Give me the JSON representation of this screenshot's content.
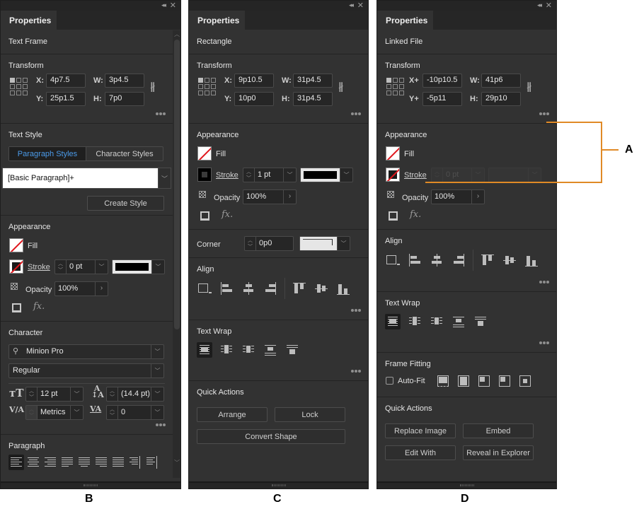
{
  "panels": {
    "b": {
      "caption": "B",
      "tab": "Properties",
      "object_type": "Text Frame",
      "transform": {
        "title": "Transform",
        "x_label": "X:",
        "y_label": "Y:",
        "w_label": "W:",
        "h_label": "H:",
        "x": "4p7.5",
        "y": "25p1.5",
        "w": "3p4.5",
        "h": "7p0"
      },
      "text_style": {
        "title": "Text Style",
        "tabs": [
          "Paragraph Styles",
          "Character Styles"
        ],
        "active_tab": "Paragraph Styles",
        "selected_style": "[Basic Paragraph]+",
        "create_button": "Create Style"
      },
      "appearance": {
        "title": "Appearance",
        "fill_label": "Fill",
        "stroke_label": "Stroke",
        "stroke_weight": "0 pt",
        "opacity_label": "Opacity",
        "opacity": "100%"
      },
      "character": {
        "title": "Character",
        "font_family": "Minion Pro",
        "font_style": "Regular",
        "font_size": "12 pt",
        "leading": "(14.4 pt)",
        "kerning": "Metrics",
        "tracking": "0"
      },
      "paragraph": {
        "title": "Paragraph"
      }
    },
    "c": {
      "caption": "C",
      "tab": "Properties",
      "object_type": "Rectangle",
      "transform": {
        "title": "Transform",
        "x_label": "X:",
        "y_label": "Y:",
        "w_label": "W:",
        "h_label": "H:",
        "x": "9p10.5",
        "y": "10p0",
        "w": "31p4.5",
        "h": "31p4.5"
      },
      "appearance": {
        "title": "Appearance",
        "fill_label": "Fill",
        "stroke_label": "Stroke",
        "stroke_weight": "1 pt",
        "opacity_label": "Opacity",
        "opacity": "100%"
      },
      "corner": {
        "label": "Corner",
        "value": "0p0"
      },
      "align": {
        "title": "Align"
      },
      "text_wrap": {
        "title": "Text Wrap"
      },
      "quick_actions": {
        "title": "Quick Actions",
        "buttons": [
          "Arrange",
          "Lock",
          "Convert Shape"
        ]
      }
    },
    "d": {
      "caption": "D",
      "tab": "Properties",
      "object_type": "Linked File",
      "transform": {
        "title": "Transform",
        "x_label": "X+",
        "y_label": "Y+",
        "w_label": "W:",
        "h_label": "H:",
        "x": "-10p10.5",
        "y": "-5p11",
        "w": "41p6",
        "h": "29p10"
      },
      "appearance": {
        "title": "Appearance",
        "fill_label": "Fill",
        "stroke_label": "Stroke",
        "stroke_weight": "0 pt",
        "opacity_label": "Opacity",
        "opacity": "100%"
      },
      "align": {
        "title": "Align"
      },
      "text_wrap": {
        "title": "Text Wrap"
      },
      "frame_fitting": {
        "title": "Frame Fitting",
        "autofit_label": "Auto-Fit",
        "autofit_checked": false
      },
      "quick_actions": {
        "title": "Quick Actions",
        "buttons": [
          "Replace Image",
          "Embed",
          "Edit With",
          "Reveal in Explorer"
        ]
      }
    }
  },
  "annotation": {
    "label": "A",
    "color": "#e08a26"
  },
  "icons": {
    "panel_collapse": "double-chevron-left-icon",
    "panel_close": "close-icon",
    "more": "ellipsis-icon",
    "constrain": "link-broken-icon"
  }
}
